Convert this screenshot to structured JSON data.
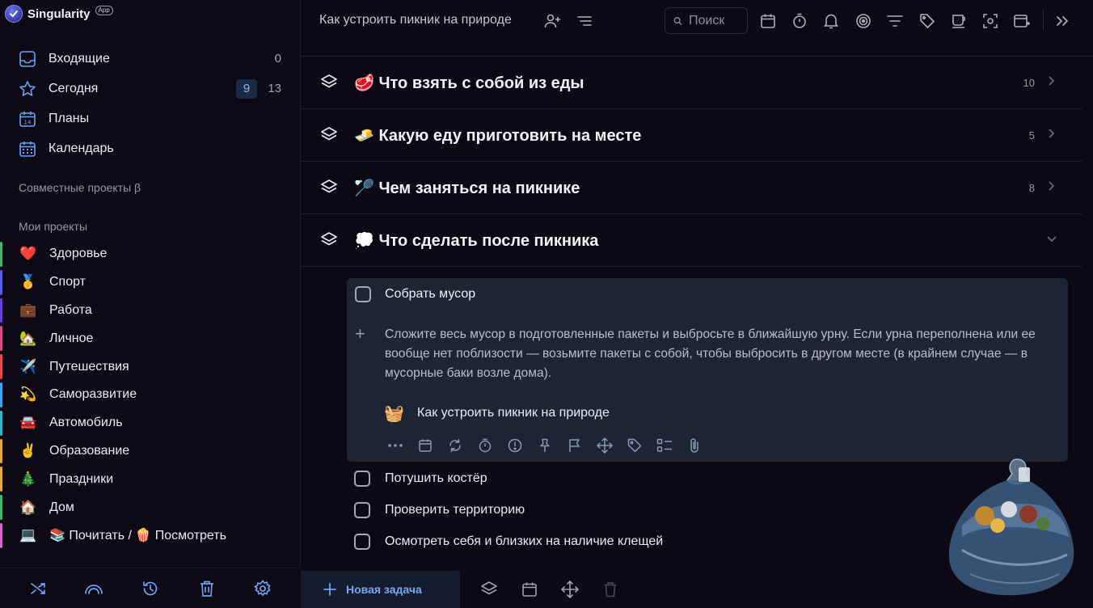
{
  "app": {
    "name": "Singularity",
    "badge": "App"
  },
  "sidebar": {
    "nav": [
      {
        "label": "Входящие",
        "count": "0",
        "icon": "inbox-icon"
      },
      {
        "label": "Сегодня",
        "count_highlight": "9",
        "count": "13",
        "icon": "star-icon"
      },
      {
        "label": "Планы",
        "icon": "calendar-14-icon"
      },
      {
        "label": "Календарь",
        "icon": "calendar-grid-icon"
      }
    ],
    "shared_title": "Совместные проекты β",
    "my_title": "Мои проекты",
    "projects": [
      {
        "emoji": "❤️",
        "label": "Здоровье",
        "color": "#4cae6a"
      },
      {
        "emoji": "🥇",
        "label": "Спорт",
        "color": "#5a5fe0"
      },
      {
        "emoji": "💼",
        "label": "Работа",
        "color": "#6a3fd8"
      },
      {
        "emoji": "🏡",
        "label": "Личное",
        "color": "#d84b8b"
      },
      {
        "emoji": "✈️",
        "label": "Путешествия",
        "color": "#e24a4a"
      },
      {
        "emoji": "💫",
        "label": "Саморазвитие",
        "color": "#3ea4e8"
      },
      {
        "emoji": "🚘",
        "label": "Автомобиль",
        "color": "#35b4c8"
      },
      {
        "emoji": "✌️",
        "label": "Образование",
        "color": "#e6a93a"
      },
      {
        "emoji": "🎄",
        "label": "Праздники",
        "color": "#e6a93a"
      },
      {
        "emoji": "🏠",
        "label": "Дом",
        "color": "#3fb86a"
      },
      {
        "emoji": "💻",
        "label": "📚 Почитать / 🍿 Посмотреть",
        "color": "#d06ac8"
      }
    ]
  },
  "topbar": {
    "title": "Как устроить пикник на природе",
    "search_placeholder": "Поиск"
  },
  "groups": [
    {
      "emoji": "🥩",
      "title": "Что взять с собой из еды",
      "count": "10"
    },
    {
      "emoji": "🧈",
      "title": "Какую еду приготовить на месте",
      "count": "5"
    },
    {
      "emoji": "🏸",
      "title": "Чем заняться на пикнике",
      "count": "8"
    },
    {
      "emoji": "💭",
      "title": "Что сделать после пикника",
      "count": ""
    }
  ],
  "active_task": {
    "title": "Собрать мусор",
    "note": "Сложите весь мусор в подготовленные пакеты и выбросьте в ближайшую урну. Если урна переполнена или ее вообще нет поблизости — возьмите пакеты с собой, чтобы выбросить в другом месте (в крайнем случае — в мусорные баки возле дома).",
    "project_emoji": "🧺",
    "project": "Как устроить пикник на природе"
  },
  "subtasks": [
    "Потушить костёр",
    "Проверить территорию",
    "Осмотреть себя и близких на наличие клещей"
  ],
  "footer": {
    "new_task": "Новая задача"
  }
}
